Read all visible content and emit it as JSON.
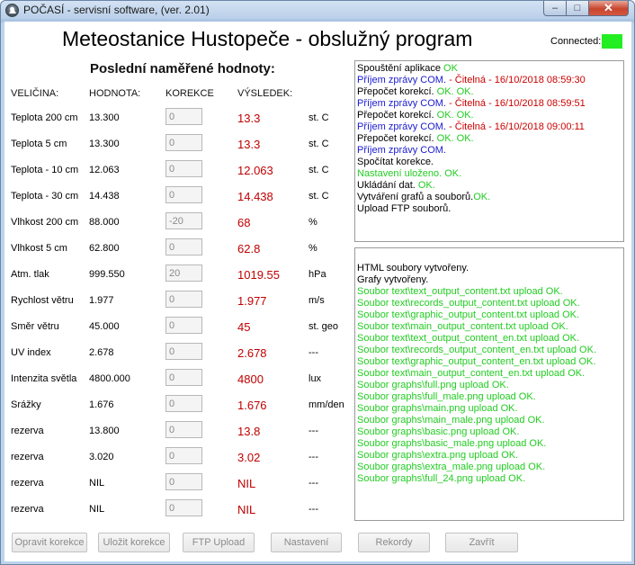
{
  "window": {
    "title": "POČASÍ - servisní software, (ver. 2.01)",
    "min": "–",
    "max": "□",
    "close": "✕"
  },
  "header": {
    "title": "Meteostanice Hustopeče - obslužný program",
    "connected_label": "Connected:",
    "connected_color": "#22ee22"
  },
  "section": {
    "title": "Poslední naměřené hodnoty:"
  },
  "columns": {
    "quantity": "VELIČINA:",
    "value": "HODNOTA:",
    "correction": "KOREKCE",
    "result": "VÝSLEDEK:"
  },
  "rows": [
    {
      "label": "Teplota 200 cm",
      "value": "13.300",
      "correction": "0",
      "result": "13.3",
      "unit": "st. C"
    },
    {
      "label": "Teplota 5 cm",
      "value": "13.300",
      "correction": "0",
      "result": "13.3",
      "unit": "st. C"
    },
    {
      "label": "Teplota - 10 cm",
      "value": "12.063",
      "correction": "0",
      "result": "12.063",
      "unit": "st. C"
    },
    {
      "label": "Teplota - 30 cm",
      "value": "14.438",
      "correction": "0",
      "result": "14.438",
      "unit": "st. C"
    },
    {
      "label": "Vlhkost 200 cm",
      "value": "88.000",
      "correction": "-20",
      "result": "68",
      "unit": "%"
    },
    {
      "label": "Vlhkost 5 cm",
      "value": "62.800",
      "correction": "0",
      "result": "62.8",
      "unit": "%"
    },
    {
      "label": "Atm. tlak",
      "value": "999.550",
      "correction": "20",
      "result": "1019.55",
      "unit": "hPa"
    },
    {
      "label": "Rychlost větru",
      "value": "1.977",
      "correction": "0",
      "result": "1.977",
      "unit": "m/s"
    },
    {
      "label": "Směr větru",
      "value": "45.000",
      "correction": "0",
      "result": "45",
      "unit": "st. geo"
    },
    {
      "label": "UV index",
      "value": "2.678",
      "correction": "0",
      "result": "2.678",
      "unit": "---"
    },
    {
      "label": "Intenzita světla",
      "value": "4800.000",
      "correction": "0",
      "result": "4800",
      "unit": "lux"
    },
    {
      "label": "Srážky",
      "value": "1.676",
      "correction": "0",
      "result": "1.676",
      "unit": "mm/den"
    },
    {
      "label": "rezerva",
      "value": "13.800",
      "correction": "0",
      "result": "13.8",
      "unit": "---"
    },
    {
      "label": "rezerva",
      "value": "3.020",
      "correction": "0",
      "result": "3.02",
      "unit": "---"
    },
    {
      "label": "rezerva",
      "value": "NIL",
      "correction": "0",
      "result": "NIL",
      "unit": "---"
    },
    {
      "label": "rezerva",
      "value": "NIL",
      "correction": "0",
      "result": "NIL",
      "unit": "---"
    }
  ],
  "log_top": [
    [
      {
        "t": "Spouštění aplikace ",
        "c": "black"
      },
      {
        "t": "OK",
        "c": "green"
      }
    ],
    [
      {
        "t": "Příjem zprávy COM.",
        "c": "blue"
      },
      {
        "t": " - Čitelná - 16/10/2018 08:59:30",
        "c": "red"
      }
    ],
    [
      {
        "t": "Přepočet korekcí. ",
        "c": "black"
      },
      {
        "t": "OK. OK.",
        "c": "green"
      }
    ],
    [
      {
        "t": "Příjem zprávy COM.",
        "c": "blue"
      },
      {
        "t": " - Čitelná - 16/10/2018 08:59:51",
        "c": "red"
      }
    ],
    [
      {
        "t": "Přepočet korekcí. ",
        "c": "black"
      },
      {
        "t": "OK. OK.",
        "c": "green"
      }
    ],
    [
      {
        "t": "Příjem zprávy COM.",
        "c": "blue"
      },
      {
        "t": " - Čitelná - 16/10/2018 09:00:11",
        "c": "red"
      }
    ],
    [
      {
        "t": "Přepočet korekcí. ",
        "c": "black"
      },
      {
        "t": "OK. OK.",
        "c": "green"
      }
    ],
    [
      {
        "t": "Příjem zprávy COM.",
        "c": "blue"
      }
    ],
    [
      {
        "t": "Spočítat korekce.",
        "c": "black"
      }
    ],
    [
      {
        "t": "Nastavení uloženo. OK.",
        "c": "green"
      }
    ],
    [
      {
        "t": "Ukládání dat. ",
        "c": "black"
      },
      {
        "t": "OK.",
        "c": "green"
      }
    ],
    [
      {
        "t": "Vytváření grafů a souborů.",
        "c": "black"
      },
      {
        "t": "OK.",
        "c": "green"
      }
    ],
    [
      {
        "t": "Upload FTP souborů.",
        "c": "black"
      }
    ]
  ],
  "log_bottom": [
    [
      {
        "t": "HTML soubory vytvořeny.",
        "c": "black"
      }
    ],
    [
      {
        "t": "Grafy vytvořeny.",
        "c": "black"
      }
    ],
    [
      {
        "t": "Soubor text\\text_output_content.txt upload OK.",
        "c": "green"
      }
    ],
    [
      {
        "t": "Soubor text\\records_output_content.txt upload OK.",
        "c": "green"
      }
    ],
    [
      {
        "t": "Soubor text\\graphic_output_content.txt upload OK.",
        "c": "green"
      }
    ],
    [
      {
        "t": "Soubor text\\main_output_content.txt upload OK.",
        "c": "green"
      }
    ],
    [
      {
        "t": "Soubor text\\text_output_content_en.txt upload OK.",
        "c": "green"
      }
    ],
    [
      {
        "t": "Soubor text\\records_output_content_en.txt upload OK.",
        "c": "green"
      }
    ],
    [
      {
        "t": "Soubor text\\graphic_output_content_en.txt upload OK.",
        "c": "green"
      }
    ],
    [
      {
        "t": "Soubor text\\main_output_content_en.txt upload OK.",
        "c": "green"
      }
    ],
    [
      {
        "t": "Soubor graphs\\full.png upload OK.",
        "c": "green"
      }
    ],
    [
      {
        "t": "Soubor graphs\\full_male.png upload OK.",
        "c": "green"
      }
    ],
    [
      {
        "t": "Soubor graphs\\main.png upload OK.",
        "c": "green"
      }
    ],
    [
      {
        "t": "Soubor graphs\\main_male.png upload OK.",
        "c": "green"
      }
    ],
    [
      {
        "t": "Soubor graphs\\basic.png upload OK.",
        "c": "green"
      }
    ],
    [
      {
        "t": "Soubor graphs\\basic_male.png upload OK.",
        "c": "green"
      }
    ],
    [
      {
        "t": "Soubor graphs\\extra.png upload OK.",
        "c": "green"
      }
    ],
    [
      {
        "t": "Soubor graphs\\extra_male.png upload OK.",
        "c": "green"
      }
    ],
    [
      {
        "t": "Soubor graphs\\full_24.png upload OK.",
        "c": "green"
      }
    ]
  ],
  "buttons": {
    "fix_corrections": "Opravit korekce",
    "save_corrections": "Uložit korekce",
    "ftp_upload": "FTP Upload",
    "settings": "Nastavení",
    "records": "Rekordy",
    "close": "Zavřít"
  }
}
